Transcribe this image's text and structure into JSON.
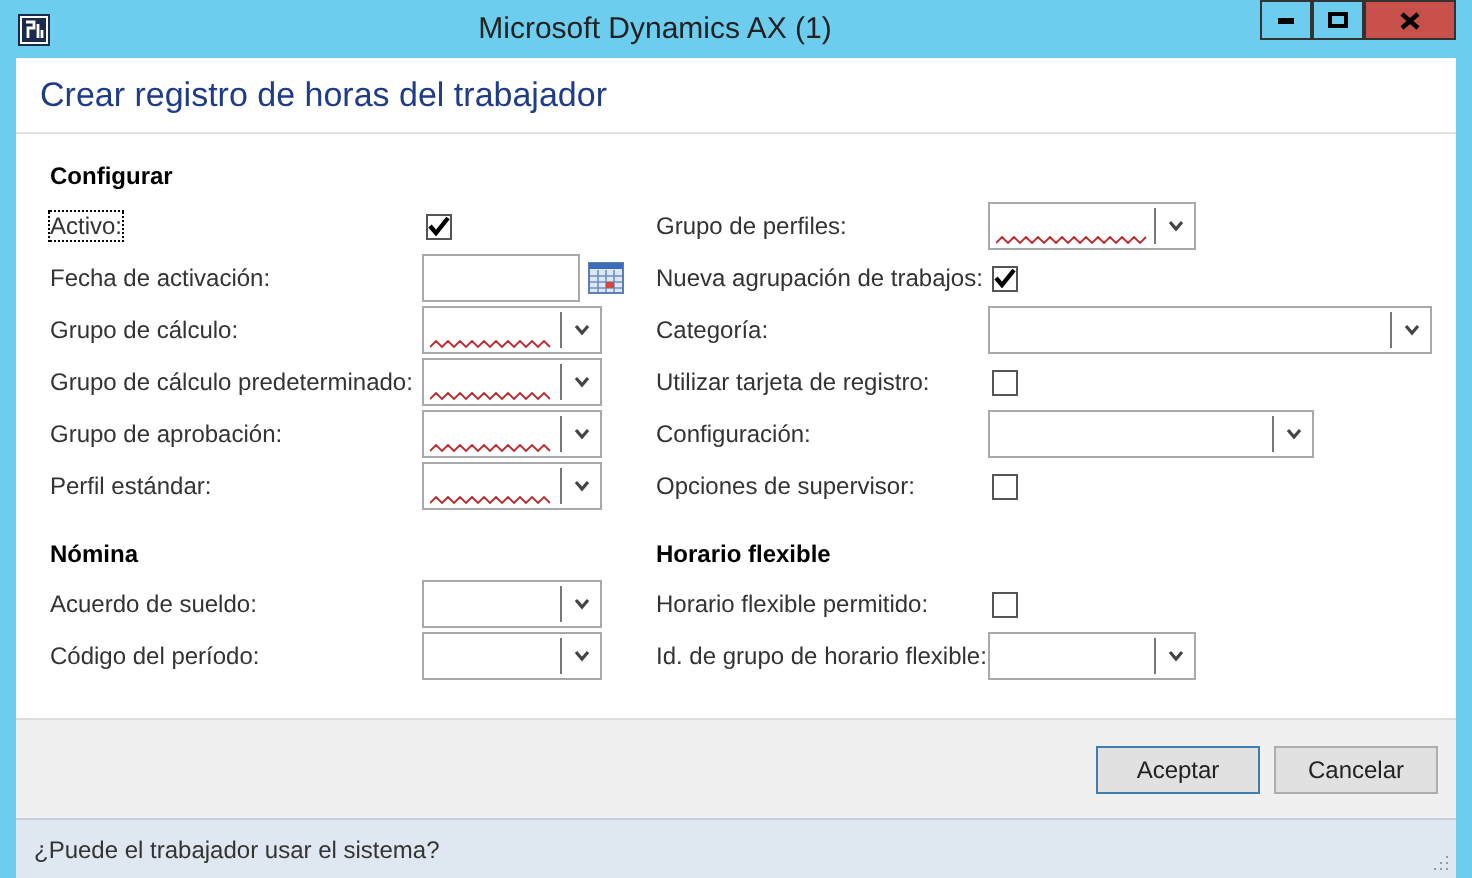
{
  "window": {
    "title": "Microsoft Dynamics AX (1)"
  },
  "form_title": "Crear registro de horas del trabajador",
  "groups": [
    {
      "left": {
        "title": "Configurar",
        "fields": [
          {
            "label": "Activo:",
            "kind": "checkbox",
            "checked": true,
            "focused": true
          },
          {
            "label": "Fecha de activación:",
            "kind": "date",
            "focused": false
          },
          {
            "label": "Grupo de cálculo:",
            "kind": "lookup",
            "required": true,
            "focused": false
          },
          {
            "label": "Grupo de cálculo predeterminado:",
            "kind": "lookup",
            "required": true,
            "focused": false
          },
          {
            "label": "Grupo de aprobación:",
            "kind": "lookup",
            "required": true,
            "focused": false
          },
          {
            "label": "Perfil estándar:",
            "kind": "lookup",
            "required": true,
            "focused": false
          }
        ]
      },
      "right": {
        "fields": [
          {
            "label": "Grupo de perfiles:",
            "kind": "lookup",
            "required": true,
            "focused": false
          },
          {
            "label": "Nueva agrupación de trabajos:",
            "kind": "checkbox",
            "checked": true,
            "focused": false
          },
          {
            "label": "Categoría:",
            "kind": "lookup",
            "required": false,
            "focused": false
          },
          {
            "label": "Utilizar tarjeta de registro:",
            "kind": "checkbox",
            "checked": false,
            "focused": false
          },
          {
            "label": "Configuración:",
            "kind": "lookup",
            "required": false,
            "focused": false
          },
          {
            "label": "Opciones de supervisor:",
            "kind": "checkbox",
            "checked": false,
            "focused": false
          }
        ]
      }
    },
    {
      "left": {
        "title": "Nómina",
        "fields": [
          {
            "label": "Acuerdo de sueldo:",
            "kind": "lookup",
            "required": false,
            "focused": false
          },
          {
            "label": "Código del período:",
            "kind": "lookup",
            "required": false,
            "focused": false
          }
        ]
      },
      "right": {
        "title": "Horario flexible",
        "fields": [
          {
            "label": "Horario flexible permitido:",
            "kind": "checkbox",
            "checked": false,
            "focused": false
          },
          {
            "label": "Id. de grupo de horario flexible:",
            "kind": "lookup",
            "required": false,
            "focused": false
          }
        ]
      }
    }
  ],
  "buttons": [
    "Aceptar",
    "Cancelar"
  ],
  "status_bar": "¿Puede el trabajador usar el sistema?"
}
